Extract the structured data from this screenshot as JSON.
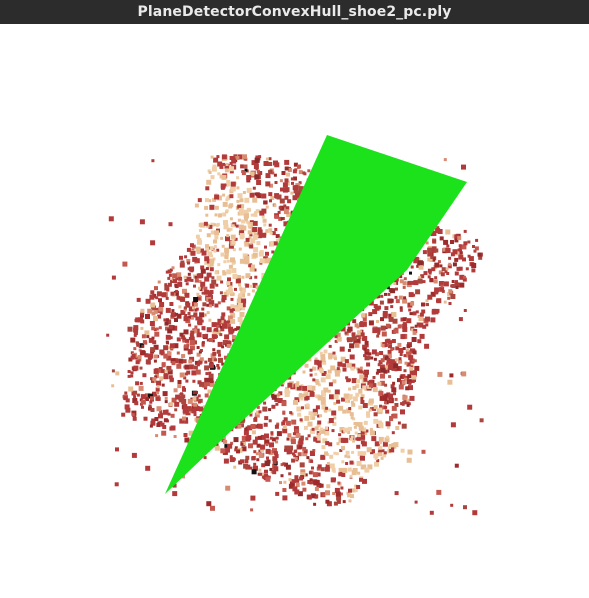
{
  "window": {
    "title": "PlaneDetectorConvexHull_shoe2_pc.ply"
  },
  "viewer": {
    "background_color": "#ffffff",
    "point_cloud": {
      "colors": [
        "#b23a3a",
        "#c4584f",
        "#9e2b2b",
        "#d98b72",
        "#e8bf95",
        "#c97a6a",
        "#a8473f",
        "#f0cfa8",
        "#8b2a2a",
        "#111111"
      ]
    },
    "plane": {
      "color": "#1be21b"
    }
  }
}
